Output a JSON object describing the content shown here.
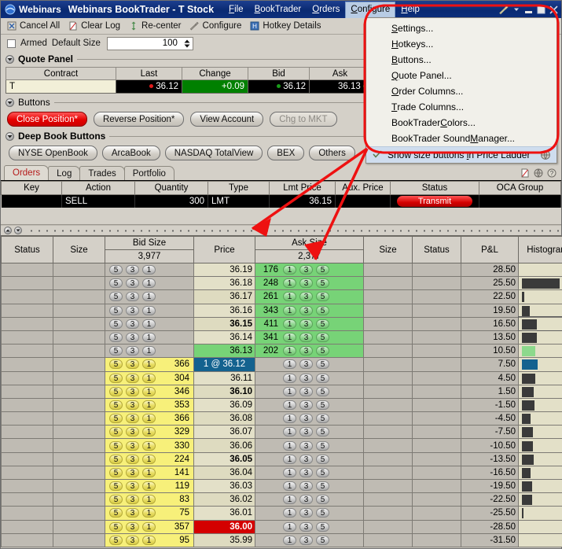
{
  "titlebar": {
    "logo_icon": "webinars-logo-icon",
    "app_name": "Webinars",
    "window_title": "Webinars BookTrader - T Stock",
    "menus": [
      {
        "label": "File",
        "mnemonic": "F"
      },
      {
        "label": "BookTrader",
        "mnemonic": "B"
      },
      {
        "label": "Orders",
        "mnemonic": "O"
      },
      {
        "label": "Configure",
        "mnemonic": "C",
        "open": true
      },
      {
        "label": "Help",
        "mnemonic": "H"
      }
    ],
    "wrench_icon": "wrench-icon",
    "wrench_dropdown_icon": "chevron-down-icon",
    "minimize_icon": "minimize-icon",
    "maximize_icon": "maximize-icon",
    "close_icon": "close-icon"
  },
  "toolbar": {
    "items": [
      {
        "label": "Cancel All",
        "icon": "cancel-all-icon"
      },
      {
        "label": "Clear Log",
        "icon": "clear-log-icon"
      },
      {
        "label": "Re-center",
        "icon": "re-center-icon"
      },
      {
        "label": "Configure",
        "icon": "configure-wrench-icon"
      },
      {
        "label": "Hotkey Details",
        "icon": "hotkey-details-icon"
      }
    ]
  },
  "armed_row": {
    "armed_label": "Armed",
    "armed_checked": false,
    "default_size_label": "Default Size",
    "default_size_value": "100"
  },
  "quote_panel": {
    "title": "Quote Panel",
    "columns": [
      "Contract",
      "Last",
      "Change",
      "Bid",
      "Ask"
    ],
    "row": {
      "contract": "T",
      "last": "36.12",
      "last_dot": "red",
      "change": "+0.09",
      "bid": "36.12",
      "bid_dot": "green",
      "ask": "36.13",
      "ask_dot": "green"
    }
  },
  "buttons_panel": {
    "title": "Buttons",
    "items": [
      {
        "label": "Close Position*",
        "style": "red"
      },
      {
        "label": "Reverse Position*",
        "style": "normal"
      },
      {
        "label": "View Account",
        "style": "normal"
      },
      {
        "label": "Chg to MKT",
        "style": "disabled"
      }
    ]
  },
  "deep_book_panel": {
    "title": "Deep Book Buttons",
    "items": [
      {
        "label": "NYSE OpenBook"
      },
      {
        "label": "ArcaBook"
      },
      {
        "label": "NASDAQ TotalView"
      },
      {
        "label": "BEX"
      },
      {
        "label": "Others"
      }
    ]
  },
  "tabs": {
    "items": [
      {
        "label": "Orders",
        "active": true
      },
      {
        "label": "Log",
        "active": false
      },
      {
        "label": "Trades",
        "active": false
      },
      {
        "label": "Portfolio",
        "active": false
      }
    ],
    "right_icons": [
      "page-cancel-icon",
      "globe-icon",
      "help-icon"
    ]
  },
  "orders_table": {
    "columns": [
      "Key",
      "Action",
      "Quantity",
      "Type",
      "Lmt Price",
      "Aux. Price",
      "Status",
      "OCA Group"
    ],
    "rows": [
      {
        "key": "",
        "action": "SELL",
        "quantity": "300",
        "type": "LMT",
        "lmt_price": "36.15",
        "aux_price": "",
        "status": "Transmit",
        "oca_group": ""
      }
    ]
  },
  "ladder": {
    "columns": [
      "Status",
      "Size",
      "Bid Size",
      "Price",
      "Ask Size",
      "Size",
      "Status",
      "P&L",
      "Histogram"
    ],
    "bid_size_total": "3,977",
    "ask_size_total": "2,377",
    "size_buttons": [
      "5",
      "3",
      "1"
    ],
    "ask_size_buttons": [
      "1",
      "3",
      "5"
    ],
    "rows": [
      {
        "price": "36.19",
        "price_style": "a",
        "bid_num": "",
        "bid_yellow": false,
        "ask_num": "176",
        "ask_green": true,
        "pnl": "28.50",
        "hist": 0,
        "hist_color": "dark"
      },
      {
        "price": "36.18",
        "price_style": "a",
        "bid_num": "",
        "bid_yellow": false,
        "ask_num": "248",
        "ask_green": true,
        "pnl": "25.50",
        "hist": 72,
        "hist_color": "dark"
      },
      {
        "price": "36.17",
        "price_style": "b",
        "bid_num": "",
        "bid_yellow": false,
        "ask_num": "261",
        "ask_green": true,
        "pnl": "22.50",
        "hist": 5,
        "hist_color": "dark"
      },
      {
        "price": "36.16",
        "price_style": "a",
        "bid_num": "",
        "bid_yellow": false,
        "ask_num": "343",
        "ask_green": true,
        "pnl": "19.50",
        "hist": 15,
        "hist_color": "dark"
      },
      {
        "price": "36.15",
        "price_style": "b bold",
        "bid_num": "",
        "bid_yellow": false,
        "ask_num": "411",
        "ask_green": true,
        "pnl": "16.50",
        "hist": 28,
        "hist_color": "dark",
        "selected": true
      },
      {
        "price": "36.14",
        "price_style": "a",
        "bid_num": "",
        "bid_yellow": false,
        "ask_num": "341",
        "ask_green": true,
        "pnl": "13.50",
        "hist": 28,
        "hist_color": "dark"
      },
      {
        "price": "36.13",
        "price_style": "green",
        "bid_num": "",
        "bid_yellow": false,
        "ask_num": "202",
        "ask_green": true,
        "pnl": "10.50",
        "hist": 26,
        "hist_color": "green"
      },
      {
        "price": "1 @ 36.12",
        "price_style": "blue",
        "bid_num": "366",
        "bid_yellow": true,
        "ask_num": "",
        "ask_green": false,
        "pnl": "7.50",
        "hist": 30,
        "hist_color": "blue"
      },
      {
        "price": "36.11",
        "price_style": "a",
        "bid_num": "304",
        "bid_yellow": true,
        "ask_num": "",
        "ask_green": false,
        "pnl": "4.50",
        "hist": 26,
        "hist_color": "dark"
      },
      {
        "price": "36.10",
        "price_style": "b bold",
        "bid_num": "346",
        "bid_yellow": true,
        "ask_num": "",
        "ask_green": false,
        "pnl": "1.50",
        "hist": 22,
        "hist_color": "dark"
      },
      {
        "price": "36.09",
        "price_style": "a",
        "bid_num": "353",
        "bid_yellow": true,
        "ask_num": "",
        "ask_green": false,
        "pnl": "-1.50",
        "hist": 24,
        "hist_color": "dark"
      },
      {
        "price": "36.08",
        "price_style": "b",
        "bid_num": "366",
        "bid_yellow": true,
        "ask_num": "",
        "ask_green": false,
        "pnl": "-4.50",
        "hist": 17,
        "hist_color": "dark"
      },
      {
        "price": "36.07",
        "price_style": "a",
        "bid_num": "329",
        "bid_yellow": true,
        "ask_num": "",
        "ask_green": false,
        "pnl": "-7.50",
        "hist": 21,
        "hist_color": "dark"
      },
      {
        "price": "36.06",
        "price_style": "b",
        "bid_num": "330",
        "bid_yellow": true,
        "ask_num": "",
        "ask_green": false,
        "pnl": "-10.50",
        "hist": 21,
        "hist_color": "dark"
      },
      {
        "price": "36.05",
        "price_style": "a bold",
        "bid_num": "224",
        "bid_yellow": true,
        "ask_num": "",
        "ask_green": false,
        "pnl": "-13.50",
        "hist": 22,
        "hist_color": "dark"
      },
      {
        "price": "36.04",
        "price_style": "b",
        "bid_num": "141",
        "bid_yellow": true,
        "ask_num": "",
        "ask_green": false,
        "pnl": "-16.50",
        "hist": 17,
        "hist_color": "dark"
      },
      {
        "price": "36.03",
        "price_style": "a",
        "bid_num": "119",
        "bid_yellow": true,
        "ask_num": "",
        "ask_green": false,
        "pnl": "-19.50",
        "hist": 19,
        "hist_color": "dark"
      },
      {
        "price": "36.02",
        "price_style": "b",
        "bid_num": "83",
        "bid_yellow": true,
        "ask_num": "",
        "ask_green": false,
        "pnl": "-22.50",
        "hist": 19,
        "hist_color": "dark"
      },
      {
        "price": "36.01",
        "price_style": "a",
        "bid_num": "75",
        "bid_yellow": true,
        "ask_num": "",
        "ask_green": false,
        "pnl": "-25.50",
        "hist": 3,
        "hist_color": "dark"
      },
      {
        "price": "36.00",
        "price_style": "red",
        "bid_num": "357",
        "bid_yellow": true,
        "ask_num": "",
        "ask_green": false,
        "pnl": "-28.50",
        "hist": 0,
        "hist_color": "dark"
      },
      {
        "price": "35.99",
        "price_style": "b",
        "bid_num": "95",
        "bid_yellow": true,
        "ask_num": "",
        "ask_green": false,
        "pnl": "-31.50",
        "hist": 0,
        "hist_color": "dark"
      }
    ]
  },
  "configure_menu": {
    "items": [
      {
        "label": "Settings...",
        "mnemonic": "S"
      },
      {
        "label": "Hotkeys...",
        "mnemonic": "H"
      },
      {
        "label": "Buttons...",
        "mnemonic": "B"
      },
      {
        "label": "Quote Panel...",
        "mnemonic": "Q"
      },
      {
        "label": "Order Columns...",
        "mnemonic": "O"
      },
      {
        "label": "Trade Columns...",
        "mnemonic": "T"
      },
      {
        "label": "BookTrader Colors...",
        "mnemonic": "C"
      },
      {
        "label": "BookTrader Sound Manager...",
        "mnemonic": "M"
      }
    ],
    "checked_item": {
      "label": "Show size buttons in Price Ladder",
      "checked": true,
      "badge_icon": "globe-icon"
    }
  },
  "annotation": {
    "highlight_color": "#ee1111",
    "arrow_color": "#ee1111"
  }
}
